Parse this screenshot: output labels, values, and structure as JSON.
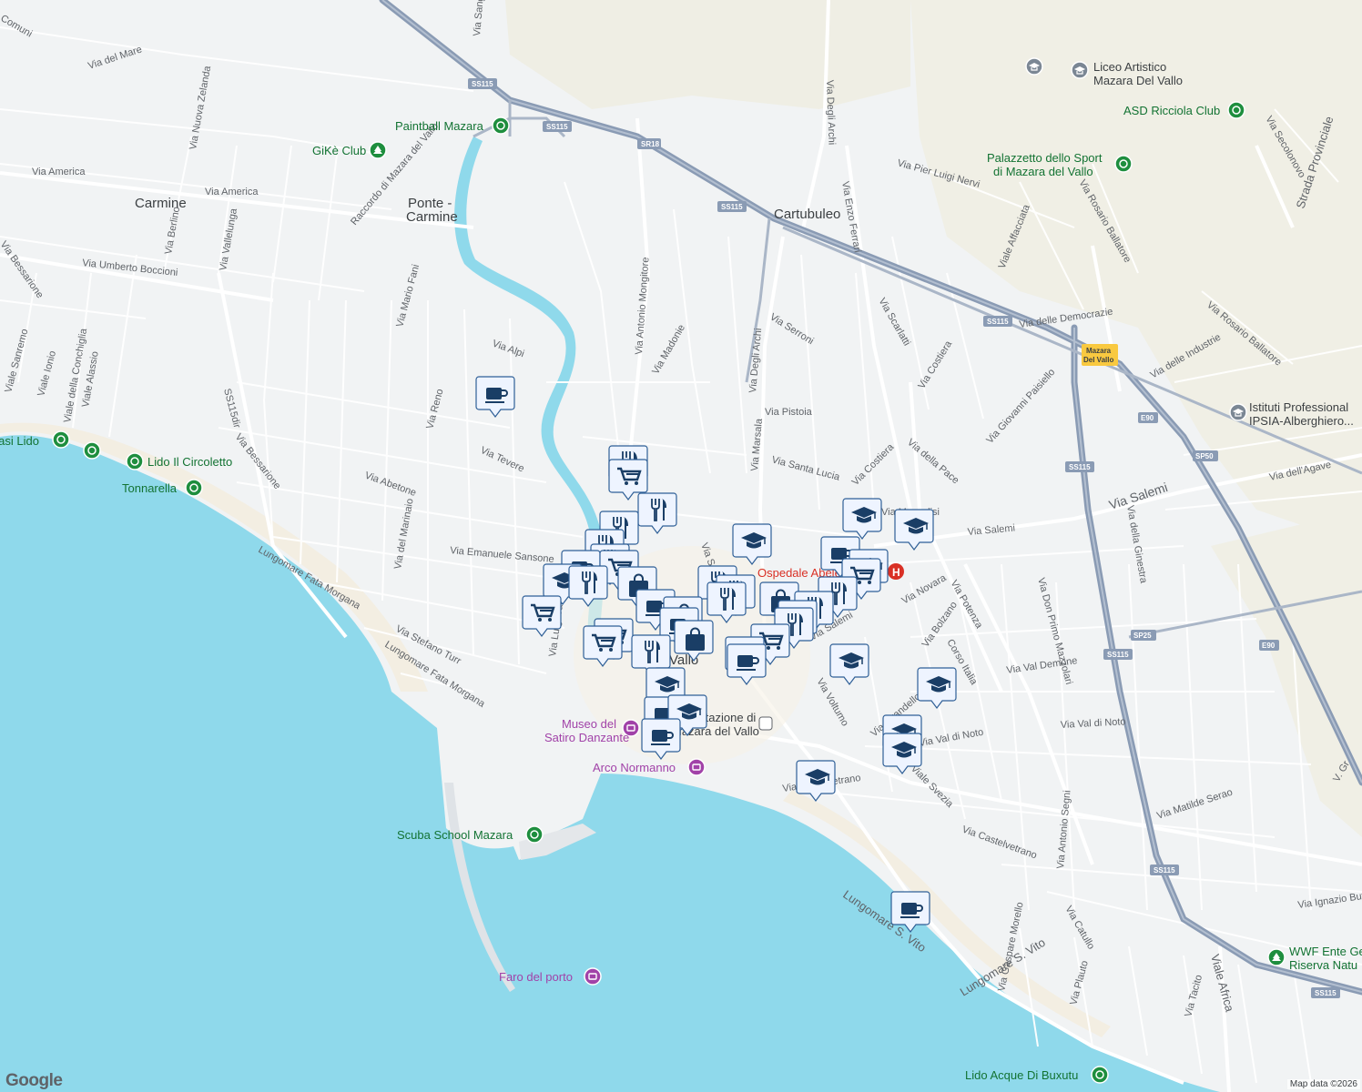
{
  "attribution": "Map data ©2026",
  "logo": "Google",
  "colors": {
    "water": "#8fd9eb",
    "land": "#f1f3f4",
    "road": "#ffffff",
    "highway": "#8a9bb4",
    "sand": "#f3eee2",
    "green_poi": "#1e8e3e",
    "marker": "#1a4c7a"
  },
  "areas": {
    "carmine": "Carmine",
    "ponte_1": "Ponte -",
    "ponte_2": "Carmine",
    "cartubuleo": "Cartubuleo",
    "vallo": "Vallo"
  },
  "pois": {
    "paintball": "Paintball Mazara",
    "gike": "GiKè Club",
    "liceo_1": "Liceo Artistico",
    "liceo_2": "Mazara Del Vallo",
    "asd": "ASD Ricciola Club",
    "palazzetto_1": "Palazzetto dello Sport",
    "palazzetto_2": "di Mazara del Vallo",
    "istituti_1": "Istituti Professional",
    "istituti_2": "IPSIA-Alberghiero...",
    "oasi": "Oasi Lido",
    "lido_circoletto": "Lido Il Circoletto",
    "tonnarella": "Tonnarella",
    "ospedale": "Ospedale Abele",
    "museo_1": "Museo del",
    "museo_2": "Satiro Danzante",
    "arco": "Arco Normanno",
    "stazione_1": "Stazione di",
    "stazione_2": "Mazara del Vallo",
    "scuba": "Scuba School Mazara",
    "faro": "Faro del porto",
    "wwf_1": "WWF Ente Ge",
    "wwf_2": "Riserva Natu",
    "lido_acque": "Lido Acque Di Buxutu"
  },
  "shields": {
    "ss115_a": "SS115",
    "ss115_b": "SS115",
    "sr18": "SR18",
    "ss115_c": "SS115",
    "ss115_d": "SS115",
    "mazara_1": "Mazara",
    "mazara_2": "Del Vallo",
    "e90_a": "E90",
    "sp50": "SP50",
    "ss115_e": "SS115",
    "sp25": "SP25",
    "ss115_f": "SS115",
    "e90_b": "E90",
    "ss115_g": "SS115",
    "ss115_h": "SS115"
  },
  "streets": {
    "comuni": "Comuni",
    "mare": "Via del Mare",
    "zelanda": "Via Nuova Zelanda",
    "america1": "Via America",
    "america2": "Via America",
    "raccordo": "Raccordo di Mazara del Vallo",
    "berlino": "Via Berlino",
    "vallelunga": "Via Vallelunga",
    "boccioni": "Via Umberto Boccioni",
    "bessarione1": "Via Bessarione",
    "fani": "Via Mario Fani",
    "alpi": "Via Alpi",
    "sanremo": "Viale Sanremo",
    "ionio": "Viale Ionio",
    "conchiglia": "Viale della Conchiglia",
    "alassio": "Viale Alassio",
    "ss115dir": "SS115dir",
    "reno": "Via Reno",
    "bessarione2": "Via Bessarione",
    "tevere": "Via Tevere",
    "abetone": "Via Abetone",
    "marinaio": "Via del Marinaio",
    "sansone": "Via Emanuele Sansone",
    "fatamorgana1": "Lungomare Fata Morgana",
    "turr": "Via Stefano Turr",
    "fatamorgana2": "Lungomare Fata Morgana",
    "vaccaro": "Via Luigi Vaccaro",
    "mongitore": "Via Antonio Mongitore",
    "madonie": "Via Madonie",
    "archi1": "Via Degli Archi",
    "archi2": "Via Degli Archi",
    "serroni": "Via Serroni",
    "pistoia": "Via Pistoia",
    "marsala": "Via Marsala",
    "santalucia": "Via Santa Lucia",
    "ferrari": "Via Enzo Ferrari",
    "nervi": "Via Pier Luigi Nervi",
    "scarlatti": "Via Scarlatti",
    "costiera1": "Via Costiera",
    "costiera2": "Via Costiera",
    "pace": "Via della Pace",
    "paisiello": "Via Giovanni Paisiello",
    "affacciata": "Viale Affacciata",
    "ballatore1": "Via Rosario Ballatore",
    "ballatore2": "Via Rosario Ballatore",
    "democrazia": "Via delle Democrazie",
    "industrie": "Via delle Industrie",
    "secolonovo": "Via Secolonovo",
    "provinciale": "Strada Provinciale",
    "agave": "Via dell'Agave",
    "salemi1": "Via Salemi",
    "salemi2": "Via Salemi",
    "salemi3": "Via Salemi",
    "mazzolisi": "Via Mazzolisi",
    "ginestra": "Via della Ginestra",
    "mazzolari": "Via Don Primo Mazzolari",
    "novara": "Via Novara",
    "potenza": "Via Potenza",
    "bolzano": "Via Bolzano",
    "corsoitalia": "Corso Italia",
    "valdemone": "Via Val Demone",
    "voltumo": "Via Voltumo",
    "pirandello": "Via Pirandello",
    "valdinoto1": "Via Val di Noto",
    "valdinoto2": "Via Val di Noto",
    "svezia": "Viale Svezia",
    "castelvetrano1": "Via Castelvetrano",
    "castelvetrano2": "Via Castelvetrano",
    "serao": "Via Matilde Serao",
    "segni": "Via Antonio Segni",
    "butera": "Via Ignazio Butera",
    "morello": "Via Gaspare Morello",
    "catullo": "Via Catullo",
    "plauto": "Via Plauto",
    "tacito": "Via Tacito",
    "viaafrica": "Viale Africa",
    "lungomaresvito1": "Lungomare S. Vito",
    "lungomaresvito2": "Lungomare S. Vito",
    "seo": "Via Seo",
    "angreco": "Via Sangreco",
    "vgr": "V. Gr"
  }
}
